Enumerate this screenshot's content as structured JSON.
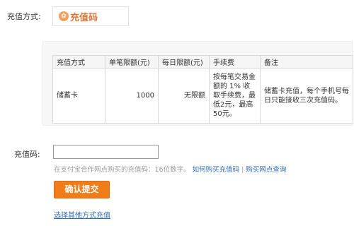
{
  "method": {
    "label": "充值方式:",
    "logo_text": "充值码",
    "logo_icon_text": "✿"
  },
  "limits_table": {
    "headers": [
      "充值方式",
      "单笔限额(元)",
      "每日限额(元)",
      "手续费",
      "备注"
    ],
    "row": {
      "method": "储蓄卡",
      "single_limit": "1000",
      "daily_limit": "无限额",
      "fee": "按每笔交易金额的 1% 收取手续费，最低2元，最高50元。",
      "note": "储蓄卡充值，每个手机号每日只能接收三次充值码。"
    }
  },
  "code": {
    "label": "充值码:",
    "value": "",
    "placeholder": ""
  },
  "hint": {
    "text": "在支付宝合作网点购买的充值码：16位数字。",
    "link_how": "如何购买充值码",
    "separator": "|",
    "link_query": "购买网点查询"
  },
  "submit_label": "确认提交",
  "other_method_link": "选择其他方式充值",
  "colors": {
    "accent": "#f07d1a",
    "link": "#2e6cb5"
  }
}
